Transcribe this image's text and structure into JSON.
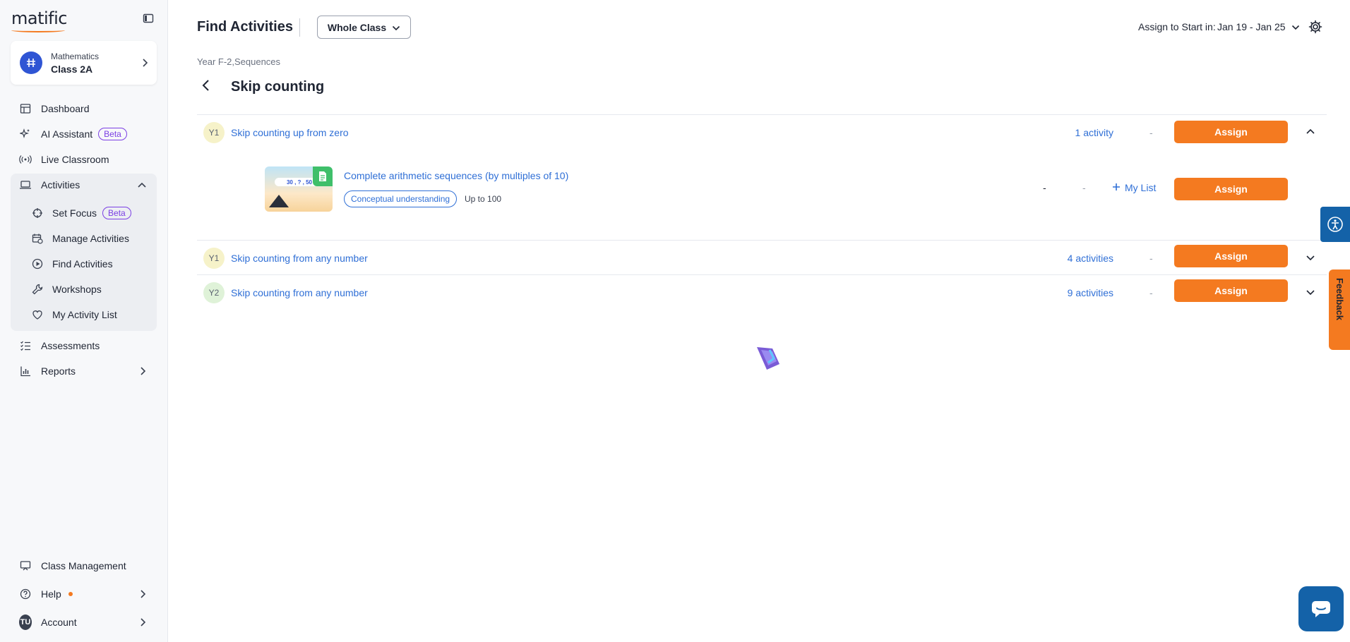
{
  "brand": {
    "logo_text": "matific",
    "accent": "#f47a20",
    "link": "#2f6fd6",
    "primary": "#1462a8"
  },
  "sidebar": {
    "class_card": {
      "subject": "Mathematics",
      "class_name": "Class 2A"
    },
    "nav": {
      "dashboard": "Dashboard",
      "ai_assistant": "AI Assistant",
      "live_classroom": "Live Classroom",
      "activities": "Activities",
      "assessments": "Assessments",
      "reports": "Reports",
      "class_management": "Class Management",
      "help": "Help",
      "account": "Account"
    },
    "activities_sub": {
      "set_focus": "Set Focus",
      "manage_activities": "Manage Activities",
      "find_activities": "Find Activities",
      "workshops": "Workshops",
      "my_activity_list": "My Activity List"
    },
    "beta_label": "Beta",
    "account_initials": "TU"
  },
  "header": {
    "title": "Find Activities",
    "class_select": "Whole Class",
    "assign_start_label": "Assign to Start in:",
    "date_range": "Jan 19 - Jan 25"
  },
  "breadcrumb": "Year F-2,Sequences",
  "topic_title": "Skip counting",
  "assign_label": "Assign",
  "dash": "-",
  "rows": [
    {
      "year": "Y1",
      "title": "Skip counting up from zero",
      "count": "1 activity",
      "expanded": true
    },
    {
      "year": "Y1",
      "title": "Skip counting from any number",
      "count": "4 activities",
      "expanded": false
    },
    {
      "year": "Y2",
      "title": "Skip counting from any number",
      "count": "9 activities",
      "expanded": false
    }
  ],
  "activity": {
    "title": "Complete arithmetic sequences (by multiples of 10)",
    "tag": "Conceptual understanding",
    "range": "Up to 100",
    "thumb_sequence": "30 , ? , 50",
    "dash1": "-",
    "dash2": "-",
    "mylist": "My List"
  },
  "feedback_label": "Feedback"
}
